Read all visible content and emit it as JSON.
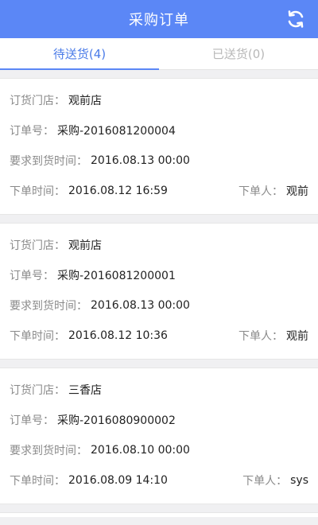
{
  "header": {
    "title": "采购订单",
    "refresh_icon": "refresh-icon"
  },
  "tabs": [
    {
      "label": "待送货(4)",
      "active": true
    },
    {
      "label": "已送货(0)",
      "active": false
    }
  ],
  "labels": {
    "store": "订货门店：",
    "order_no": "订单号：",
    "delivery_time": "要求到货时间：",
    "order_time": "下单时间：",
    "orderer": "下单人："
  },
  "orders": [
    {
      "store": "观前店",
      "order_no": "采购-2016081200004",
      "delivery_time": "2016.08.13 00:00",
      "order_time": "2016.08.12 16:59",
      "orderer": "观前"
    },
    {
      "store": "观前店",
      "order_no": "采购-2016081200001",
      "delivery_time": "2016.08.13 00:00",
      "order_time": "2016.08.12 10:36",
      "orderer": "观前"
    },
    {
      "store": "三香店",
      "order_no": "采购-2016080900002",
      "delivery_time": "2016.08.10 00:00",
      "order_time": "2016.08.09 14:10",
      "orderer": "sys"
    }
  ],
  "colors": {
    "accent": "#5b87f6",
    "tab_active": "#4a7be8"
  }
}
